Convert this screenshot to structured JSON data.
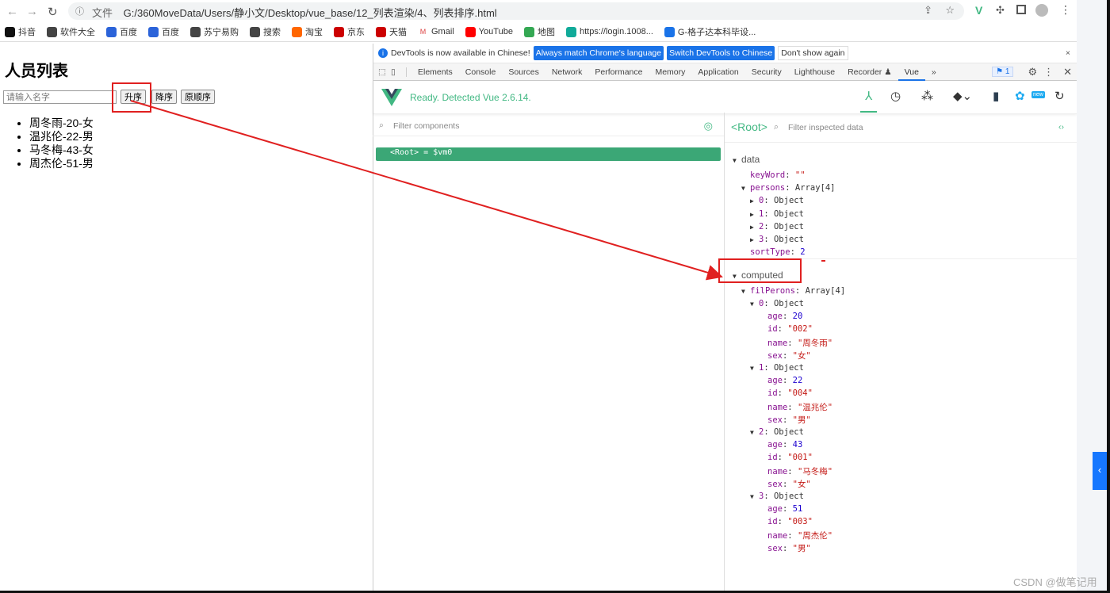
{
  "browser": {
    "url_label": "文件",
    "url": "G:/360MoveData/Users/静小文/Desktop/vue_base/12_列表渲染/4、列表排序.html",
    "bookmarks": [
      "抖音",
      "软件大全",
      "百度",
      "百度",
      "苏宁易购",
      "搜索",
      "淘宝",
      "京东",
      "天猫",
      "Gmail",
      "YouTube",
      "地图",
      "https://login.1008...",
      "G-格子达本科毕设..."
    ]
  },
  "page": {
    "title": "人员列表",
    "search_placeholder": "请输入名字",
    "buttons": [
      "升序",
      "降序",
      "原顺序"
    ],
    "persons": [
      "周冬雨-20-女",
      "温兆伦-22-男",
      "马冬梅-43-女",
      "周杰伦-51-男"
    ]
  },
  "devtools": {
    "infobar": {
      "message": "DevTools is now available in Chinese!",
      "match": "Always match Chrome's language",
      "switch": "Switch DevTools to Chinese",
      "dismiss": "Don't show again",
      "close": "×"
    },
    "tabs": [
      "Elements",
      "Console",
      "Sources",
      "Network",
      "Performance",
      "Memory",
      "Application",
      "Security",
      "Lighthouse",
      "Recorder ♟",
      "Vue",
      "»"
    ],
    "active_tab": "Vue",
    "issues_count": "1",
    "vue": {
      "status": "Ready. Detected Vue 2.6.14.",
      "filter_components": "Filter components",
      "root_label": "<Root>",
      "filter_data": "Filter inspected data",
      "root_row": "<Root> = $vm0"
    },
    "tree": [
      {
        "d": 0,
        "t": "sec",
        "open": true,
        "label": "data"
      },
      {
        "d": 1,
        "k": "keyWord",
        "v": "\"\"",
        "vt": "s"
      },
      {
        "d": 1,
        "open": true,
        "k": "persons",
        "v": "Array[4]"
      },
      {
        "d": 2,
        "open": false,
        "k": "0",
        "v": "Object"
      },
      {
        "d": 2,
        "open": false,
        "k": "1",
        "v": "Object"
      },
      {
        "d": 2,
        "open": false,
        "k": "2",
        "v": "Object"
      },
      {
        "d": 2,
        "open": false,
        "k": "3",
        "v": "Object"
      },
      {
        "d": 1,
        "k": "sortType",
        "v": "2",
        "vt": "n"
      },
      {
        "d": 0,
        "t": "sec",
        "open": true,
        "label": "computed"
      },
      {
        "d": 1,
        "open": true,
        "k": "filPerons",
        "v": "Array[4]"
      },
      {
        "d": 2,
        "open": true,
        "k": "0",
        "v": "Object"
      },
      {
        "d": 3,
        "k": "age",
        "v": "20",
        "vt": "n"
      },
      {
        "d": 3,
        "k": "id",
        "v": "\"002\"",
        "vt": "s"
      },
      {
        "d": 3,
        "k": "name",
        "v": "\"周冬雨\"",
        "vt": "s"
      },
      {
        "d": 3,
        "k": "sex",
        "v": "\"女\"",
        "vt": "s"
      },
      {
        "d": 2,
        "open": true,
        "k": "1",
        "v": "Object"
      },
      {
        "d": 3,
        "k": "age",
        "v": "22",
        "vt": "n"
      },
      {
        "d": 3,
        "k": "id",
        "v": "\"004\"",
        "vt": "s"
      },
      {
        "d": 3,
        "k": "name",
        "v": "\"温兆伦\"",
        "vt": "s"
      },
      {
        "d": 3,
        "k": "sex",
        "v": "\"男\"",
        "vt": "s"
      },
      {
        "d": 2,
        "open": true,
        "k": "2",
        "v": "Object"
      },
      {
        "d": 3,
        "k": "age",
        "v": "43",
        "vt": "n"
      },
      {
        "d": 3,
        "k": "id",
        "v": "\"001\"",
        "vt": "s"
      },
      {
        "d": 3,
        "k": "name",
        "v": "\"马冬梅\"",
        "vt": "s"
      },
      {
        "d": 3,
        "k": "sex",
        "v": "\"女\"",
        "vt": "s"
      },
      {
        "d": 2,
        "open": true,
        "k": "3",
        "v": "Object"
      },
      {
        "d": 3,
        "k": "age",
        "v": "51",
        "vt": "n"
      },
      {
        "d": 3,
        "k": "id",
        "v": "\"003\"",
        "vt": "s"
      },
      {
        "d": 3,
        "k": "name",
        "v": "\"周杰伦\"",
        "vt": "s"
      },
      {
        "d": 3,
        "k": "sex",
        "v": "\"男\"",
        "vt": "s"
      }
    ]
  },
  "watermark": "CSDN @做笔记用",
  "colors": {
    "vue_green": "#42b883",
    "key": "#881391",
    "number": "#1c00cf",
    "string": "#c41a16",
    "annotation": "#e02020",
    "chrome_blue": "#1a73e8"
  }
}
